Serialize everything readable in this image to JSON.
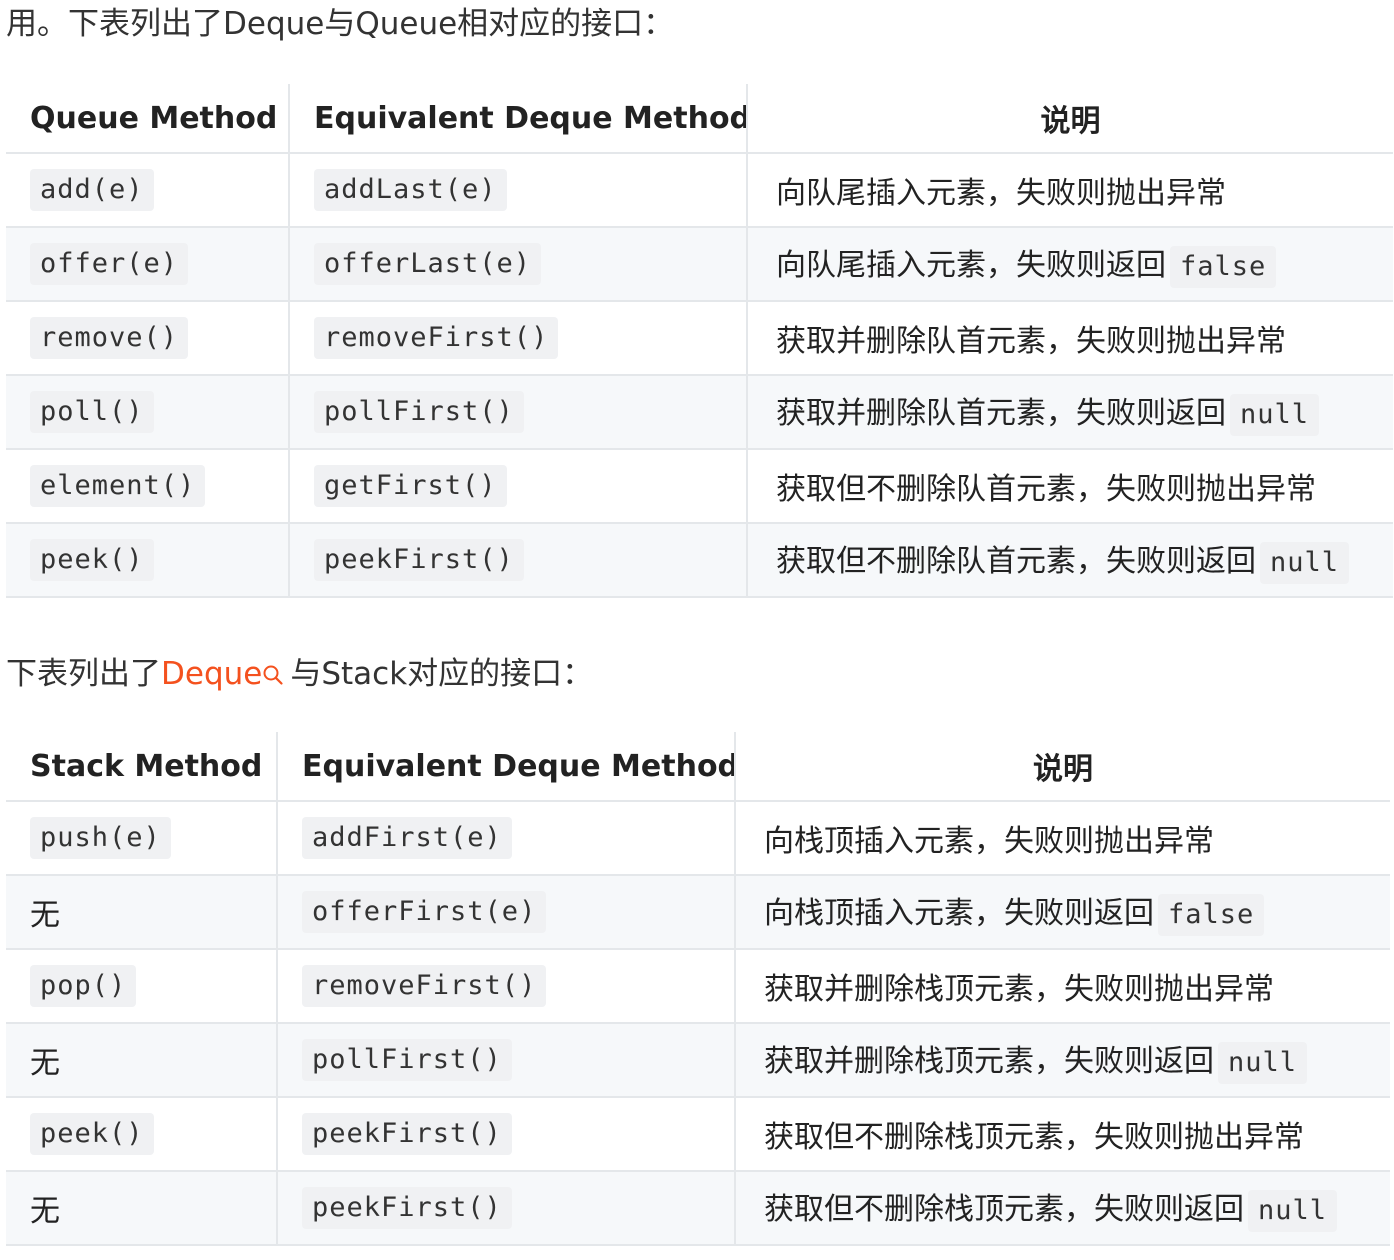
{
  "intro_text": "用。下表列出了Deque与Queue相对应的接口：",
  "table1": {
    "headers": [
      "Queue Method",
      "Equivalent Deque Method",
      "说明"
    ],
    "rows": [
      {
        "method": "add(e)",
        "equivalent": "addLast(e)",
        "desc": "向队尾插入元素，失败则抛出异常",
        "desc_code": ""
      },
      {
        "method": "offer(e)",
        "equivalent": "offerLast(e)",
        "desc": "向队尾插入元素，失败则返回",
        "desc_code": "false"
      },
      {
        "method": "remove()",
        "equivalent": "removeFirst()",
        "desc": "获取并删除队首元素，失败则抛出异常",
        "desc_code": ""
      },
      {
        "method": "poll()",
        "equivalent": "pollFirst()",
        "desc": "获取并删除队首元素，失败则返回",
        "desc_code": "null"
      },
      {
        "method": "element()",
        "equivalent": "getFirst()",
        "desc": "获取但不删除队首元素，失败则抛出异常",
        "desc_code": ""
      },
      {
        "method": "peek()",
        "equivalent": "peekFirst()",
        "desc": "获取但不删除队首元素，失败则返回",
        "desc_code": "null"
      }
    ]
  },
  "stack_intro": {
    "before": "下表列出了",
    "link": "Deque",
    "after": "与Stack对应的接口："
  },
  "table2": {
    "headers": [
      "Stack Method",
      "Equivalent Deque Method",
      "说明"
    ],
    "rows": [
      {
        "method": "push(e)",
        "method_is_code": true,
        "equivalent": "addFirst(e)",
        "desc": "向栈顶插入元素，失败则抛出异常",
        "desc_code": ""
      },
      {
        "method": "无",
        "method_is_code": false,
        "equivalent": "offerFirst(e)",
        "desc": "向栈顶插入元素，失败则返回",
        "desc_code": "false"
      },
      {
        "method": "pop()",
        "method_is_code": true,
        "equivalent": "removeFirst()",
        "desc": "获取并删除栈顶元素，失败则抛出异常",
        "desc_code": ""
      },
      {
        "method": "无",
        "method_is_code": false,
        "equivalent": "pollFirst()",
        "desc": "获取并删除栈顶元素，失败则返回",
        "desc_code": "null"
      },
      {
        "method": "peek()",
        "method_is_code": true,
        "equivalent": "peekFirst()",
        "desc": "获取但不删除栈顶元素，失败则抛出异常",
        "desc_code": ""
      },
      {
        "method": "无",
        "method_is_code": false,
        "equivalent": "peekFirst()",
        "desc": "获取但不删除栈顶元素，失败则返回",
        "desc_code": "null"
      }
    ]
  },
  "colors": {
    "link": "#f4511e",
    "border": "#e4e7ea",
    "stripe": "#f6f8fa",
    "code_bg": "#f0f1f3"
  },
  "icons": {
    "link_search": "search-icon"
  }
}
